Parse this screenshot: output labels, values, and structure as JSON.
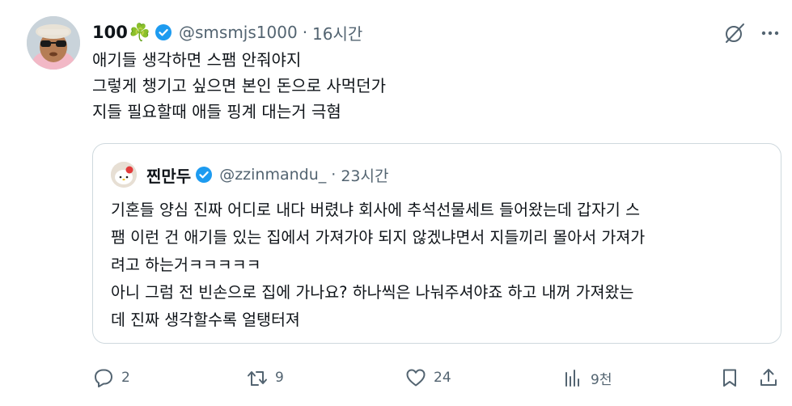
{
  "author": {
    "display_name": "100",
    "emoji": "☘️",
    "handle": "@smsmjs1000",
    "separator": "·",
    "time": "16시간"
  },
  "tweet": {
    "lines": [
      "애기들 생각하면 스팸 안줘야지",
      "그렇게 챙기고 싶으면 본인 돈으로 사먹던가",
      "지들 필요할때 애들 핑계 대는거 극혐"
    ]
  },
  "quote": {
    "display_name": "찐만두",
    "handle": "@zzinmandu_",
    "separator": "·",
    "time": "23시간",
    "lines": [
      "기혼들 양심 진짜 어디로 내다 버렸냐 회사에 추석선물세트 들어왔는데 갑자기 스",
      "팸 이런 건 애기들 있는 집에서 가져가야 되지 않겠냐면서 지들끼리 몰아서 가져가",
      "려고 하는거ㅋㅋㅋㅋㅋ",
      "아니 그럼 전 빈손으로 집에 가나요? 하나씩은 나눠주셔야죠 하고 내꺼 가져왔는",
      "데 진짜 생각할수록 얼탱터져"
    ]
  },
  "actions": {
    "replies": "2",
    "reposts": "9",
    "likes": "24",
    "views": "9천"
  },
  "colors": {
    "text": "#0f1419",
    "muted": "#536471",
    "verified": "#1d9bf0",
    "border": "#cfd9de"
  }
}
